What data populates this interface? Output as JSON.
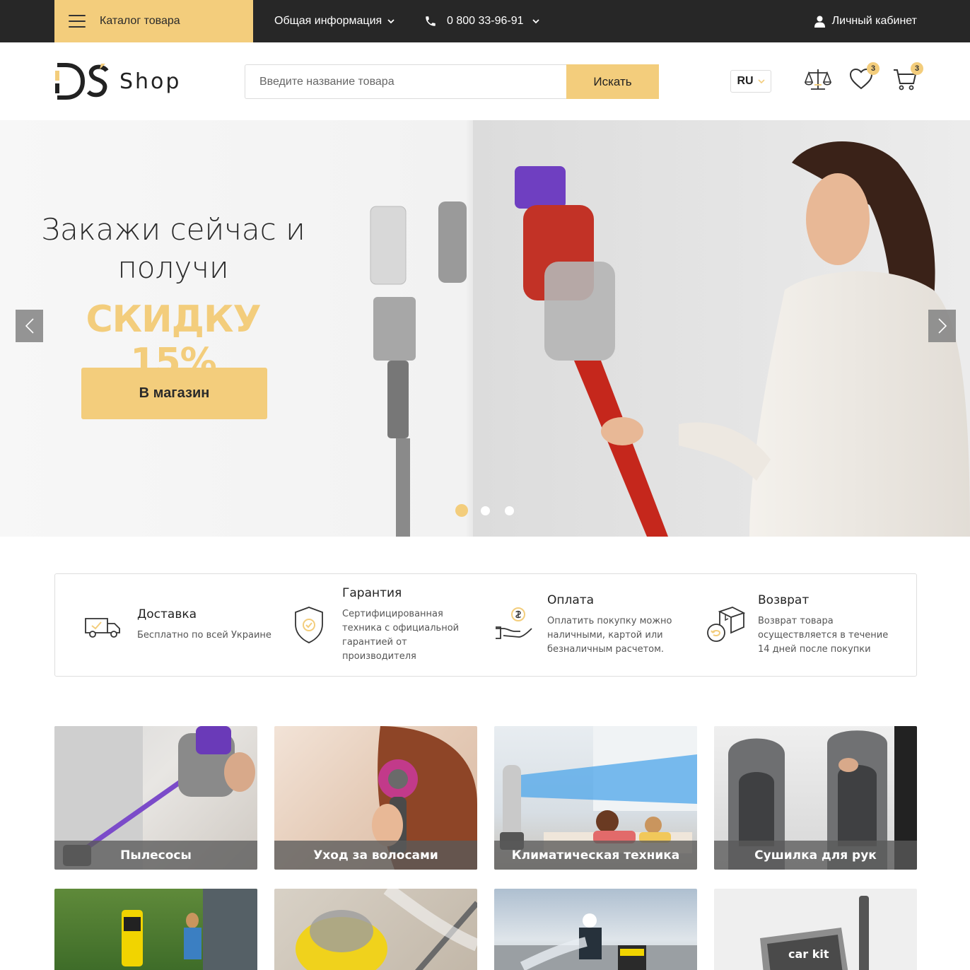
{
  "topbar": {
    "catalog_label": "Каталог товара",
    "info_label": "Общая информация",
    "phone": "0 800 33-96-91",
    "account_label": "Личный кабинет"
  },
  "header": {
    "logo_text": "Shop",
    "search_placeholder": "Введите название товара",
    "search_button": "Искать",
    "language": "RU",
    "wishlist_count": "3",
    "cart_count": "3"
  },
  "hero": {
    "line1": "Закажи сейчас и",
    "line2": "получи",
    "discount": "СКИДКУ 15%",
    "cta": "В магазин",
    "slides_count": 3,
    "active_slide": 1
  },
  "features": [
    {
      "icon": "delivery-truck-icon",
      "title": "Доставка",
      "desc": "Бесплатно по всей Украине"
    },
    {
      "icon": "shield-icon",
      "title": "Гарантия",
      "desc": "Сертифицированная техника с официальной гарантией от производителя"
    },
    {
      "icon": "payment-hand-icon",
      "title": "Оплата",
      "desc": "Оплатить покупку можно наличными, картой или безналичным расчетом."
    },
    {
      "icon": "return-box-icon",
      "title": "Возврат",
      "desc": "Возврат товара осуществляется в течение 14 дней после покупки"
    }
  ],
  "categories": [
    {
      "label": "Пылесосы"
    },
    {
      "label": "Уход за волосами"
    },
    {
      "label": "Климатическая техника"
    },
    {
      "label": "Сушилка для рук"
    }
  ],
  "colors": {
    "accent": "#f3cd7c",
    "topbar": "#272727"
  }
}
